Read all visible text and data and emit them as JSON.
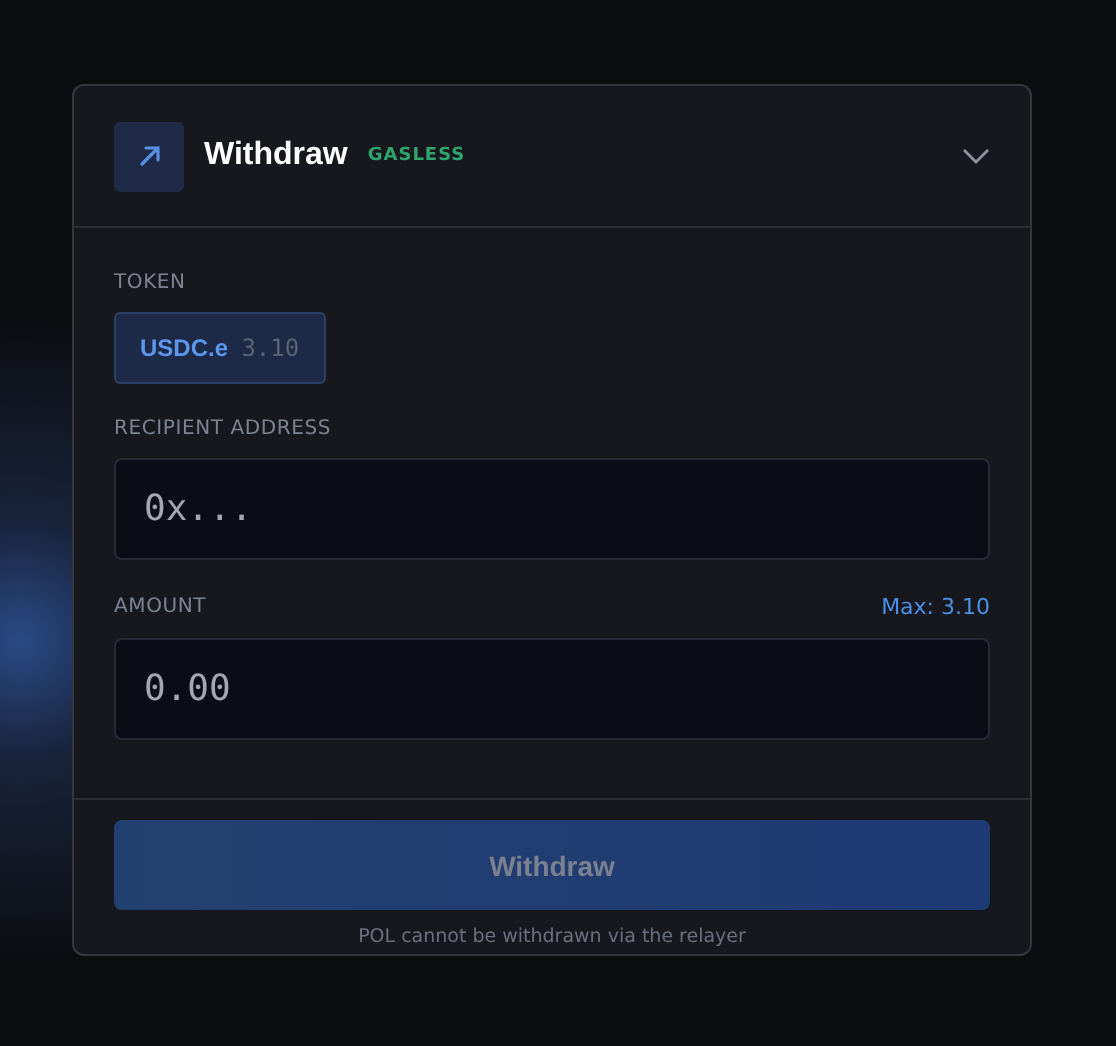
{
  "panel": {
    "title": "Withdraw",
    "badge": "GASLESS",
    "expanded": true
  },
  "token": {
    "label": "TOKEN",
    "options": [
      {
        "symbol": "USDC.e",
        "balance": "3.10",
        "selected": true
      }
    ]
  },
  "recipient": {
    "label": "RECIPIENT ADDRESS",
    "placeholder": "0x..."
  },
  "amount": {
    "label": "AMOUNT",
    "max": "Max: 3.10",
    "placeholder": "0.00"
  },
  "submit": {
    "label": "Withdraw",
    "disabled": true
  },
  "note": "POL cannot be withdrawn via the relayer"
}
